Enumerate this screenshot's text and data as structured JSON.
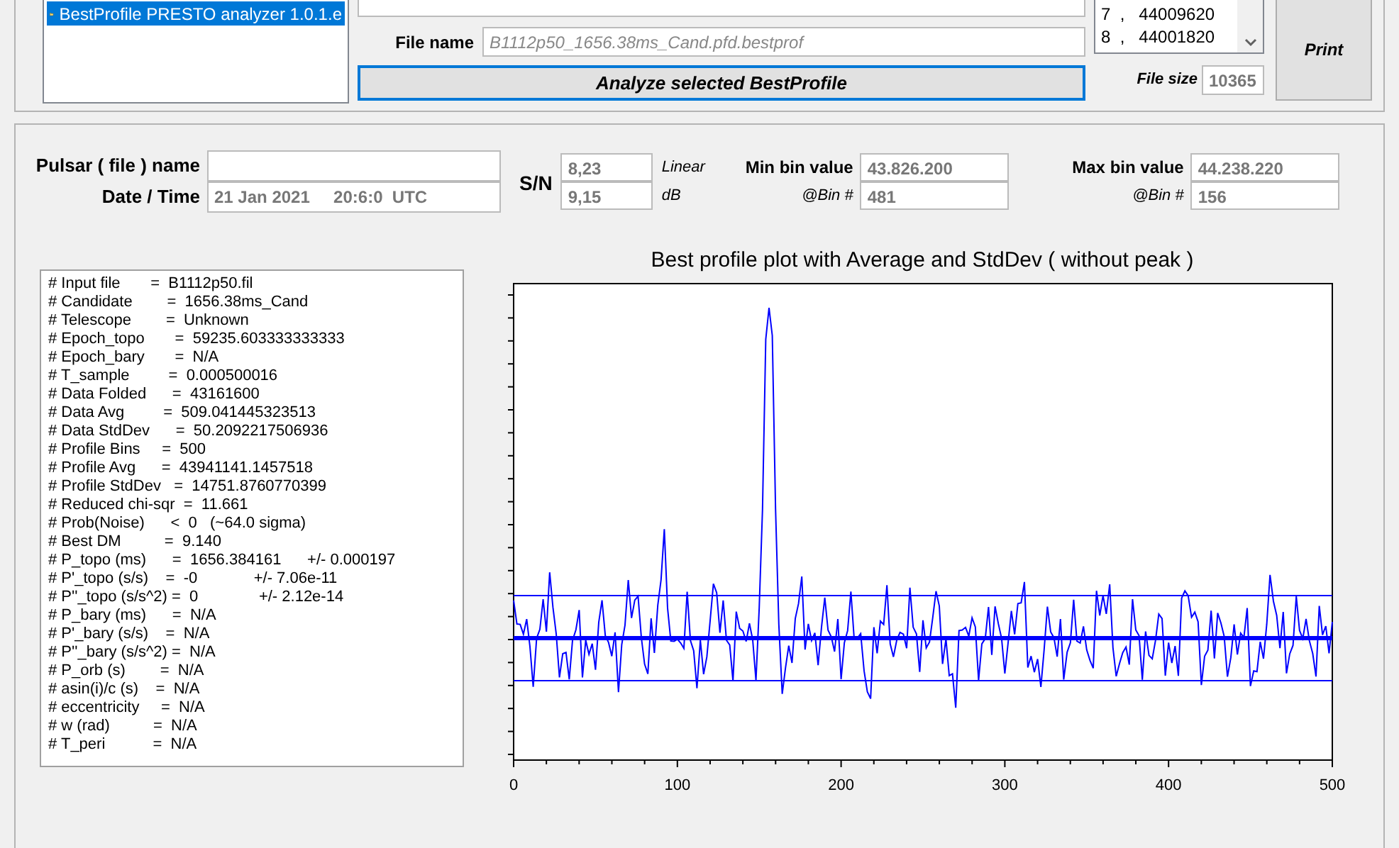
{
  "file_tree": {
    "items": [
      {
        "label": "BestProfile PRESTO analyzer 1.0.1.e",
        "selected": true
      }
    ]
  },
  "file_name": {
    "label": "File name",
    "value": "B1112p50_1656.38ms_Cand.pfd.bestprof"
  },
  "analyze_button": "Analyze selected BestProfile",
  "values_list": [
    "7  ,   44009620",
    "8  ,   44001820"
  ],
  "file_size": {
    "label": "File size",
    "value": "10365"
  },
  "print_button": "Print",
  "pulsar": {
    "name_label": "Pulsar ( file ) name",
    "date_label": "Date / Time",
    "date_value": "21 Jan 2021     20:6:0  UTC"
  },
  "sn": {
    "label": "S/N",
    "linear": "8,23",
    "linear_unit": "Linear",
    "db": "9,15",
    "db_unit": "dB"
  },
  "min_bin": {
    "label": "Min bin value",
    "value": "43.826.200",
    "bin_label": "@Bin #",
    "bin": "481"
  },
  "max_bin": {
    "label": "Max bin value",
    "value": "44.238.220",
    "bin_label": "@Bin #",
    "bin": "156"
  },
  "header_lines": [
    "# Input file       =  B1112p50.fil",
    "# Candidate        =  1656.38ms_Cand",
    "# Telescope        =  Unknown",
    "# Epoch_topo       =  59235.603333333333",
    "# Epoch_bary       =  N/A",
    "# T_sample         =  0.000500016",
    "# Data Folded      =  43161600",
    "# Data Avg         =  509.041445323513",
    "# Data StdDev      =  50.2092217506936",
    "# Profile Bins     =  500",
    "# Profile Avg      =  43941141.1457518",
    "# Profile StdDev   =  14751.8760770399",
    "# Reduced chi-sqr  =  11.661",
    "# Prob(Noise)      <  0   (~64.0 sigma)",
    "# Best DM          =  9.140",
    "# P_topo (ms)      =  1656.384161      +/- 0.000197",
    "# P'_topo (s/s)    =  -0             +/- 7.06e-11",
    "# P''_topo (s/s^2) =  0              +/- 2.12e-14",
    "# P_bary (ms)      =  N/A",
    "# P'_bary (s/s)    =  N/A",
    "# P''_bary (s/s^2) =  N/A",
    "# P_orb (s)        =  N/A",
    "# asin(i)/c (s)    =  N/A",
    "# eccentricity     =  N/A",
    "# w (rad)          =  N/A",
    "# T_peri           =  N/A"
  ],
  "chart": {
    "title": "Best profile plot with  Average and StdDev ( without peak )",
    "x_tick_labels": [
      "0",
      "100",
      "200",
      "300",
      "400",
      "500"
    ]
  }
}
